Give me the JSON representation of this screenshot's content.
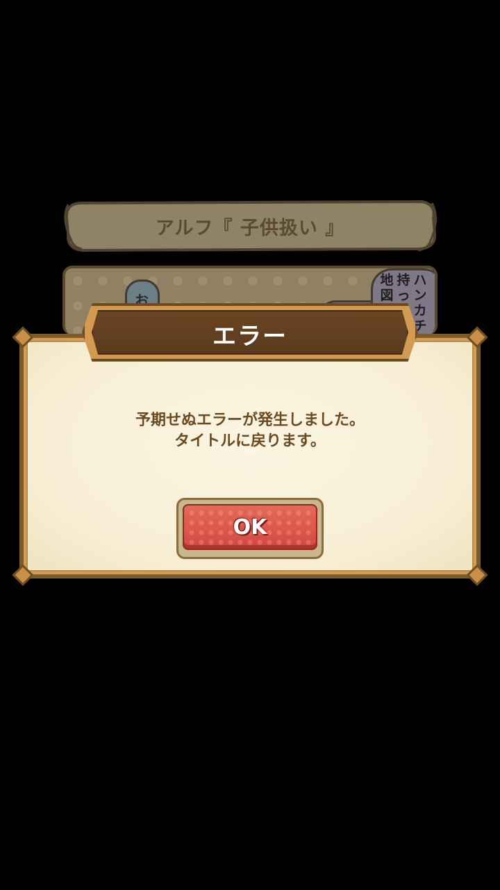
{
  "background": {
    "banner_title": "アルフ『 子供扱い 』",
    "left_bubble_text": "お",
    "right_columns": [
      "地図",
      "持っ",
      "ハンカチ"
    ]
  },
  "dialog": {
    "title": "エラー",
    "message_line1": "予期せぬエラーが発生しました。",
    "message_line2": "タイトルに戻ります。",
    "ok_label": "OK"
  },
  "colors": {
    "dialog_text": "#6b4a22",
    "ok_button": "#d14840",
    "header_plate": "#5a3a1e"
  }
}
